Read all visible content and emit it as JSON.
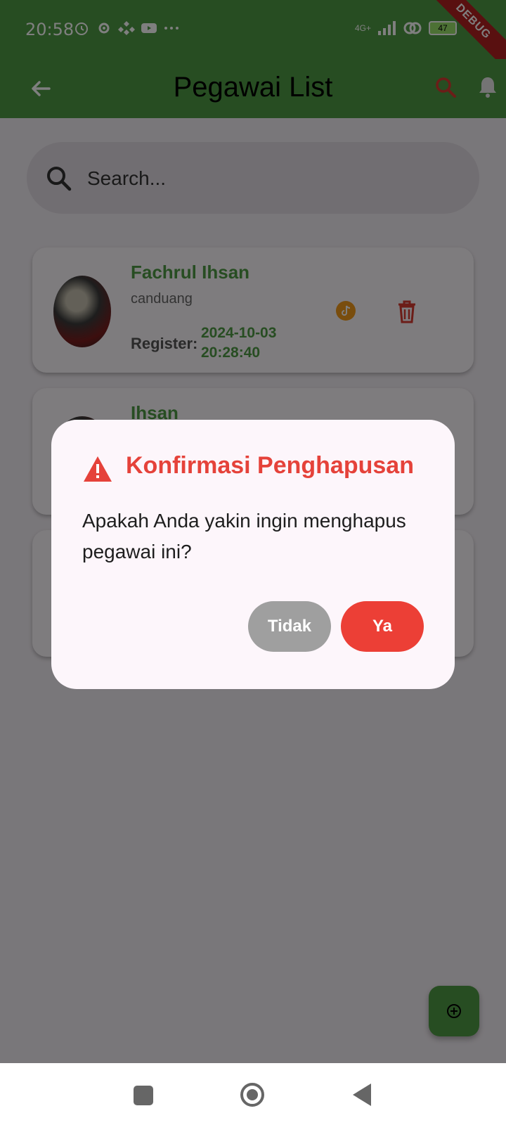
{
  "status_bar": {
    "time": "20:58",
    "network": "4G+",
    "battery": "47",
    "debug_banner": "DEBUG"
  },
  "app_bar": {
    "title": "Pegawai List",
    "back_icon": "arrow-left-icon",
    "search_icon": "search-icon",
    "bell_icon": "bell-icon"
  },
  "search": {
    "placeholder": "Search..."
  },
  "employees": [
    {
      "name": "Fachrul Ihsan",
      "username": "canduang",
      "register_label": "Register:",
      "register_date": "2024-10-03",
      "register_time": "20:28:40"
    },
    {
      "name": "Ihsan"
    }
  ],
  "dialog": {
    "title": "Konfirmasi Penghapusan",
    "message": "Apakah Anda yakin ingin menghapus pegawai ini?",
    "cancel_label": "Tidak",
    "confirm_label": "Ya"
  },
  "colors": {
    "primary": "#4f9a45",
    "danger": "#ec3f36",
    "neutral_button": "#9f9f9f",
    "dialog_bg": "#fdf6fb"
  }
}
